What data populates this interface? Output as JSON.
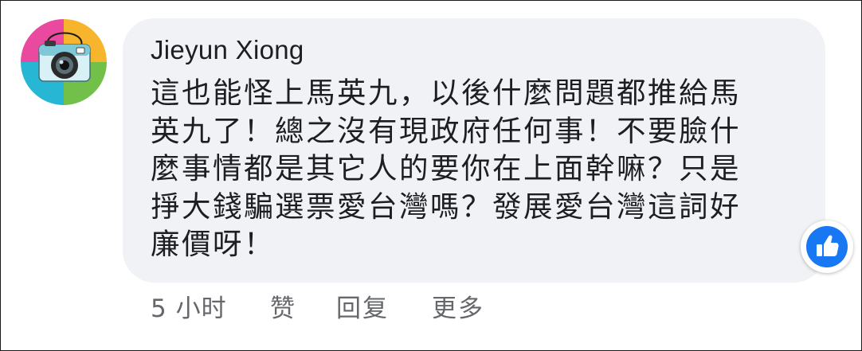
{
  "comment": {
    "author": "Jieyun Xiong",
    "lines": [
      "這也能怪上馬英九，以後什麼問題都推給馬",
      "英九了！總之沒有現政府任何事！不要臉什",
      "麼事情都是其它人的要你在上面幹嘛？只是",
      "掙大錢騙選票愛台灣嗎？發展愛台灣這詞好",
      "廉價呀！"
    ],
    "reaction": "like-icon"
  },
  "actions": {
    "time": "5 小时",
    "like": "赞",
    "reply": "回复",
    "more": "更多"
  },
  "colors": {
    "bubble": "#f0f2f5",
    "text": "#1c1e21",
    "meta": "#65676b",
    "like": "#1877f2"
  }
}
